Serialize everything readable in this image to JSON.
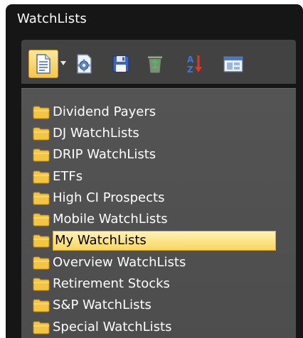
{
  "window": {
    "title": "WatchLists"
  },
  "toolbar": {
    "buttons": [
      {
        "name": "new-document",
        "icon": "document-icon"
      },
      {
        "name": "dropdown",
        "icon": "chevron-down-icon"
      },
      {
        "name": "settings",
        "icon": "gear-document-icon"
      },
      {
        "name": "save",
        "icon": "floppy-disk-icon"
      },
      {
        "name": "recycle",
        "icon": "recycle-bin-icon"
      },
      {
        "name": "sort-az",
        "icon": "sort-az-icon"
      },
      {
        "name": "window",
        "icon": "window-icon"
      }
    ]
  },
  "tree": {
    "items": [
      {
        "label": "Dividend Payers"
      },
      {
        "label": "DJ WatchLists"
      },
      {
        "label": "DRIP WatchLists"
      },
      {
        "label": "ETFs"
      },
      {
        "label": "High CI Prospects"
      },
      {
        "label": "Mobile WatchLists"
      },
      {
        "label": "My WatchLists",
        "selected": true
      },
      {
        "label": "Overview WatchLists"
      },
      {
        "label": "Retirement Stocks"
      },
      {
        "label": "S&P WatchLists"
      },
      {
        "label": "Special WatchLists"
      }
    ]
  },
  "colors": {
    "folder": "#f4c542",
    "selection": "#f8d660",
    "background": "#161616",
    "panel": "#4f4f4f"
  }
}
